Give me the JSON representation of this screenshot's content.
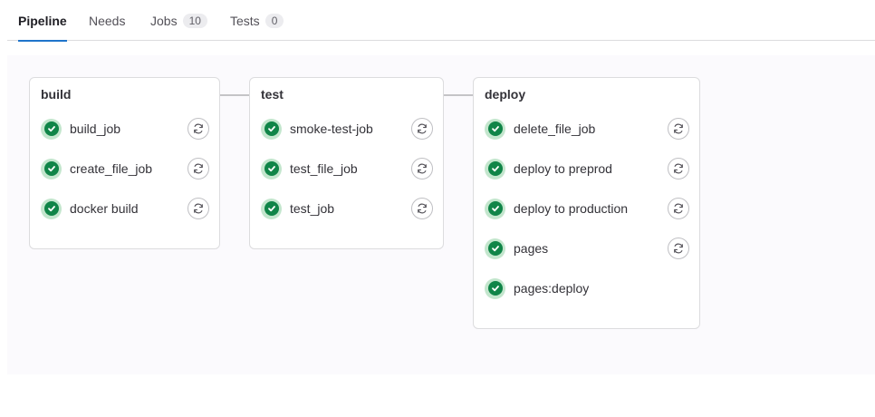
{
  "tabs": {
    "pipeline": {
      "label": "Pipeline"
    },
    "needs": {
      "label": "Needs"
    },
    "jobs": {
      "label": "Jobs",
      "count": "10"
    },
    "tests": {
      "label": "Tests",
      "count": "0"
    }
  },
  "stages": [
    {
      "name": "build",
      "jobs": [
        {
          "name": "build_job",
          "status": "success",
          "retry": true
        },
        {
          "name": "create_file_job",
          "status": "success",
          "retry": true
        },
        {
          "name": "docker build",
          "status": "success",
          "retry": true
        }
      ]
    },
    {
      "name": "test",
      "jobs": [
        {
          "name": "smoke-test-job",
          "status": "success",
          "retry": true
        },
        {
          "name": "test_file_job",
          "status": "success",
          "retry": true
        },
        {
          "name": "test_job",
          "status": "success",
          "retry": true
        }
      ]
    },
    {
      "name": "deploy",
      "jobs": [
        {
          "name": "delete_file_job",
          "status": "success",
          "retry": true
        },
        {
          "name": "deploy to preprod",
          "status": "success",
          "retry": true
        },
        {
          "name": "deploy to production",
          "status": "success",
          "retry": true
        },
        {
          "name": "pages",
          "status": "success",
          "retry": true
        },
        {
          "name": "pages:deploy",
          "status": "success",
          "retry": false
        }
      ]
    }
  ],
  "icons": {
    "status": "check-circle-icon",
    "retry": "retry-icon"
  },
  "colors": {
    "success": "#108548",
    "success_ring": "#c3e6cd",
    "active_tab": "#1f75cb"
  }
}
